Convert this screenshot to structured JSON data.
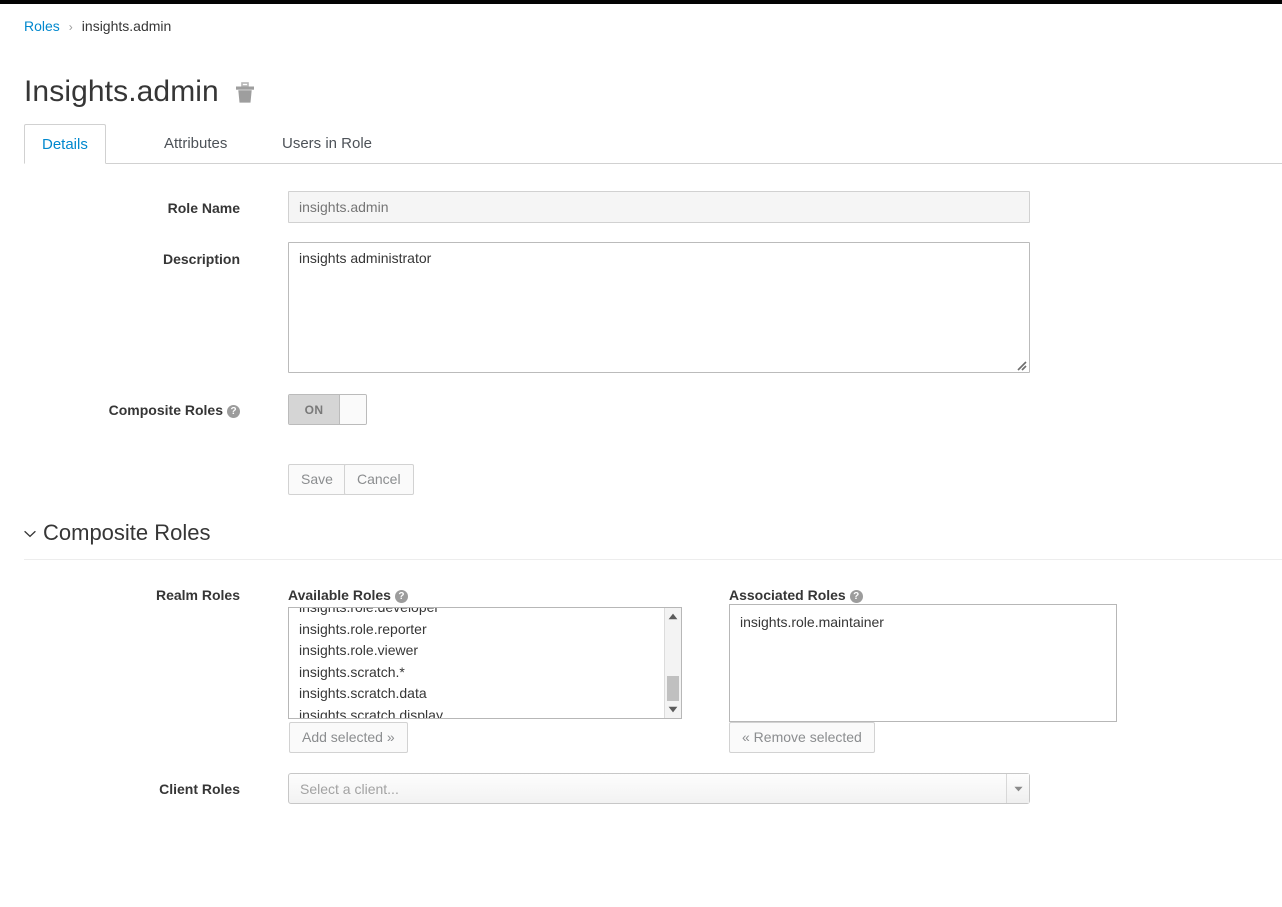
{
  "breadcrumb": {
    "parent": "Roles",
    "separator": "›",
    "current": "insights.admin"
  },
  "header": {
    "title": "Insights.admin",
    "delete_icon": "trash-icon"
  },
  "tabs": [
    {
      "label": "Details",
      "active": true
    },
    {
      "label": "Attributes",
      "active": false
    },
    {
      "label": "Users in Role",
      "active": false
    }
  ],
  "form": {
    "role_name": {
      "label": "Role Name",
      "value": "insights.admin",
      "placeholder": "insights.admin",
      "readonly": true
    },
    "description": {
      "label": "Description",
      "value": "insights administrator",
      "placeholder": ""
    },
    "composite_roles": {
      "label": "Composite Roles",
      "help_icon": "question-circle-icon",
      "toggle_state": "ON",
      "toggle_on_label": "ON"
    },
    "save_label": "Save",
    "cancel_label": "Cancel"
  },
  "composite_section": {
    "caret_icon": "chevron-down-icon",
    "title": "Composite Roles",
    "realm_roles_label": "Realm Roles",
    "client_roles_label": "Client Roles",
    "available": {
      "label": "Available Roles",
      "help_icon": "question-circle-icon",
      "items": [
        "insights.role.developer",
        "insights.role.reporter",
        "insights.role.viewer",
        "insights.scratch.*",
        "insights.scratch.data",
        "insights.scratch.display"
      ],
      "add_button": "Add selected »",
      "scroll_up_icon": "caret-up-icon",
      "scroll_down_icon": "caret-down-icon"
    },
    "associated": {
      "label": "Associated Roles",
      "help_icon": "question-circle-icon",
      "items": [
        "insights.role.maintainer"
      ],
      "remove_button": "« Remove selected"
    },
    "client_select": {
      "placeholder": "Select a client...",
      "value": "Select a client...",
      "arrow_icon": "caret-down-icon"
    }
  },
  "colors": {
    "link": "#0088ce",
    "text": "#363636",
    "muted": "#8b8d8f",
    "border": "#d1d1d1"
  }
}
